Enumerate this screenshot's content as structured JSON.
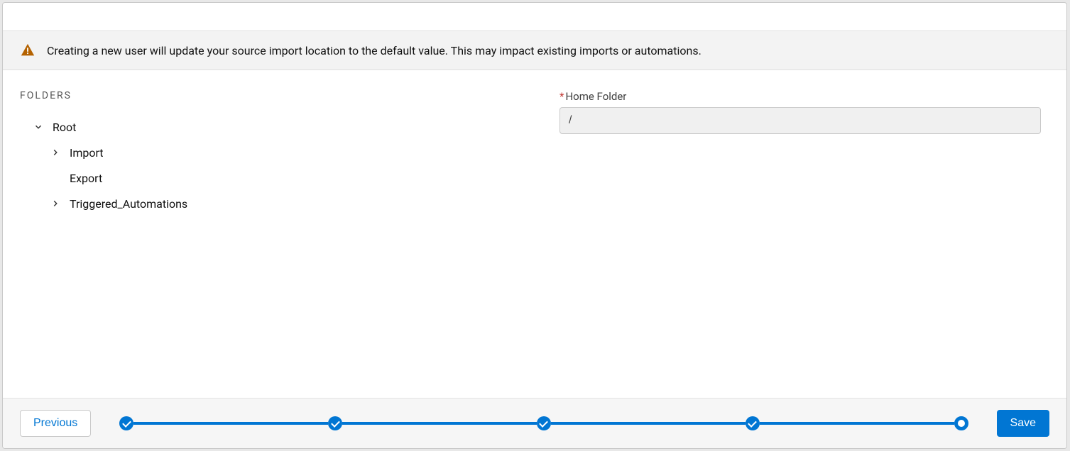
{
  "alert": {
    "text": "Creating a new user will update your source import location to the default value. This may impact existing imports or automations."
  },
  "folders": {
    "heading": "FOLDERS",
    "tree": {
      "root_label": "Root",
      "children": [
        {
          "label": "Import",
          "expandable": true
        },
        {
          "label": "Export",
          "expandable": false
        },
        {
          "label": "Triggered_Automations",
          "expandable": true
        }
      ]
    }
  },
  "home_folder": {
    "label": "Home Folder",
    "value": "/"
  },
  "footer": {
    "previous": "Previous",
    "save": "Save",
    "steps": {
      "total": 5,
      "completed": 4
    }
  }
}
